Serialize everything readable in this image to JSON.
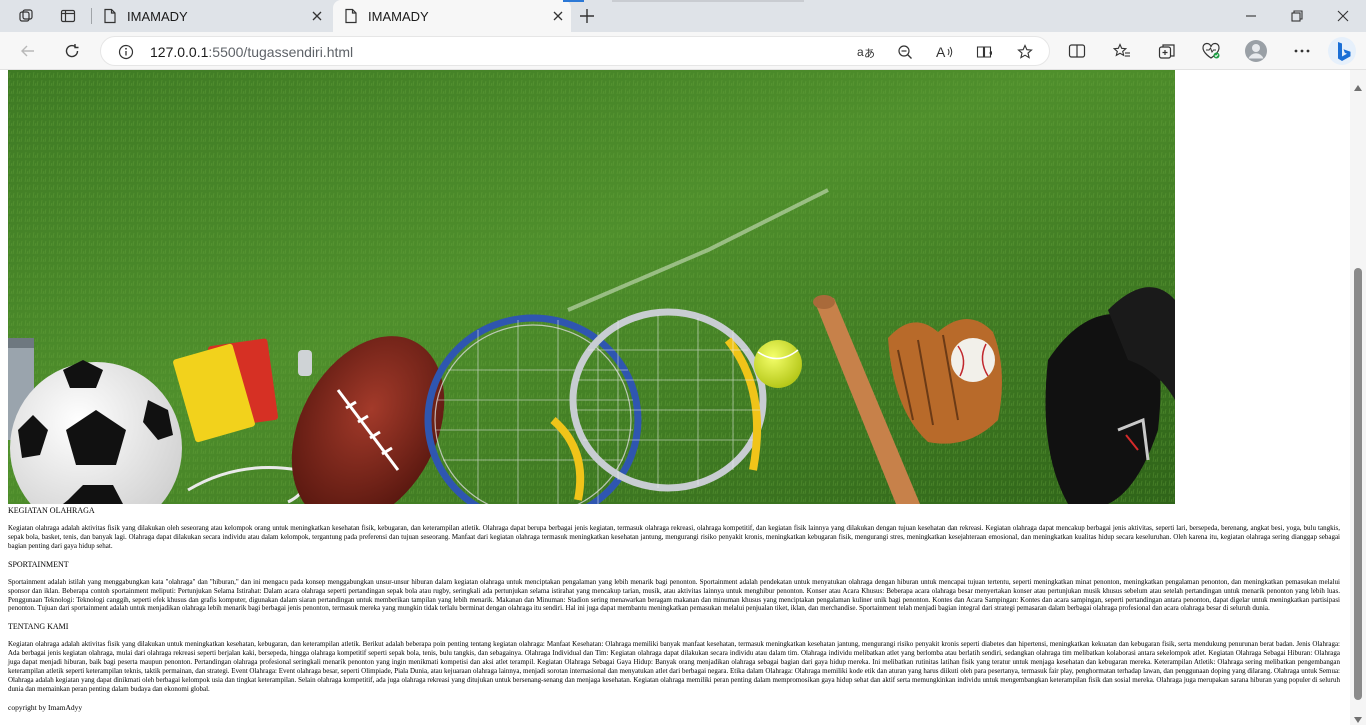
{
  "browser": {
    "tabs": [
      {
        "title": "IMAMADY",
        "active": false
      },
      {
        "title": "IMAMADY",
        "active": true
      }
    ],
    "url_host": "127.0.0.1",
    "url_path": ":5500/tugassendiri.html",
    "accent_color": "#2b78d6"
  },
  "page": {
    "hero_image": "sports-equipment-on-grass",
    "sections": [
      {
        "heading": "KEGIATAN OLAHRAGA",
        "text": "Kegiatan olahraga adalah aktivitas fisik yang dilakukan oleh seseorang atau kelompok orang untuk meningkatkan kesehatan fisik, kebugaran, dan keterampilan atletik. Olahraga dapat berupa berbagai jenis kegiatan, termasuk olahraga rekreasi, olahraga kompetitif, dan kegiatan fisik lainnya yang dilakukan dengan tujuan kesehatan dan rekreasi. Kegiatan olahraga dapat mencakup berbagai jenis aktivitas, seperti lari, bersepeda, berenang, angkat besi, yoga, bulu tangkis, sepak bola, basket, tenis, dan banyak lagi. Olahraga dapat dilakukan secara individu atau dalam kelompok, tergantung pada preferensi dan tujuan seseorang. Manfaat dari kegiatan olahraga termasuk meningkatkan kesehatan jantung, mengurangi risiko penyakit kronis, meningkatkan kebugaran fisik, mengurangi stres, meningkatkan kesejahteraan emosional, dan meningkatkan kualitas hidup secara keseluruhan. Oleh karena itu, kegiatan olahraga sering dianggap sebagai bagian penting dari gaya hidup sehat."
      },
      {
        "heading": "SPORTAINMENT",
        "text": "Sportainment adalah istilah yang menggabungkan kata \"olahraga\" dan \"hiburan,\" dan ini mengacu pada konsep menggabungkan unsur-unsur hiburan dalam kegiatan olahraga untuk menciptakan pengalaman yang lebih menarik bagi penonton. Sportainment adalah pendekatan untuk menyatukan olahraga dengan hiburan untuk mencapai tujuan tertentu, seperti meningkatkan minat penonton, meningkatkan pengalaman penonton, dan meningkatkan pemasukan melalui sponsor dan iklan. Beberapa contoh sportainment meliputi: Pertunjukan Selama Istirahat: Dalam acara olahraga seperti pertandingan sepak bola atau rugby, seringkali ada pertunjukan selama istirahat yang mencakup tarian, musik, atau aktivitas lainnya untuk menghibur penonton. Konser atau Acara Khusus: Beberapa acara olahraga besar menyertakan konser atau pertunjukan musik khusus sebelum atau setelah pertandingan untuk menarik penonton yang lebih luas. Penggunaan Teknologi: Teknologi canggih, seperti efek khusus dan grafis komputer, digunakan dalam siaran pertandingan untuk memberikan tampilan yang lebih menarik. Makanan dan Minuman: Stadion sering menawarkan beragam makanan dan minuman khusus yang menciptakan pengalaman kuliner unik bagi penonton. Kontes dan Acara Sampingan: Kontes dan acara sampingan, seperti pertandingan antara penonton, dapat digelar untuk meningkatkan partisipasi penonton. Tujuan dari sportainment adalah untuk menjadikan olahraga lebih menarik bagi berbagai jenis penonton, termasuk mereka yang mungkin tidak terlalu berminat dengan olahraga itu sendiri. Hal ini juga dapat membantu meningkatkan pemasukan melalui penjualan tiket, iklan, dan merchandise. Sportainment telah menjadi bagian integral dari strategi pemasaran dalam berbagai olahraga profesional dan acara olahraga besar di seluruh dunia."
      },
      {
        "heading": "TENTANG KAMI",
        "text": "Kegiatan olahraga adalah aktivitas fisik yang dilakukan untuk meningkatkan kesehatan, kebugaran, dan keterampilan atletik. Berikut adalah beberapa poin penting tentang kegiatan olahraga: Manfaat Kesehatan: Olahraga memiliki banyak manfaat kesehatan, termasuk meningkatkan kesehatan jantung, mengurangi risiko penyakit kronis seperti diabetes dan hipertensi, meningkatkan kekuatan dan kebugaran fisik, serta mendukung penurunan berat badan. Jenis Olahraga: Ada berbagai jenis kegiatan olahraga, mulai dari olahraga rekreasi seperti berjalan kaki, bersepeda, hingga olahraga kompetitif seperti sepak bola, tenis, bulu tangkis, dan sebagainya. Olahraga Individual dan Tim: Kegiatan olahraga dapat dilakukan secara individu atau dalam tim. Olahraga individu melibatkan atlet yang berlomba atau berlatih sendiri, sedangkan olahraga tim melibatkan kolaborasi antara sekelompok atlet. Kegiatan Olahraga Sebagai Hiburan: Olahraga juga dapat menjadi hiburan, baik bagi peserta maupun penonton. Pertandingan olahraga profesional seringkali menarik penonton yang ingin menikmati kompetisi dan aksi atlet terampil. Kegiatan Olahraga Sebagai Gaya Hidup: Banyak orang menjadikan olahraga sebagai bagian dari gaya hidup mereka. Ini melibatkan rutinitas latihan fisik yang teratur untuk menjaga kesehatan dan kebugaran mereka. Keterampilan Atletik: Olahraga sering melibatkan pengembangan keterampilan atletik seperti keterampilan teknis, taktik permainan, dan strategi. Event Olahraga: Event olahraga besar, seperti Olimpiade, Piala Dunia, atau kejuaraan olahraga lainnya, menjadi sorotan internasional dan menyatukan atlet dari berbagai negara. Etika dalam Olahraga: Olahraga memiliki kode etik dan aturan yang harus diikuti oleh para pesertanya, termasuk fair play, penghormatan terhadap lawan, dan penggunaan doping yang dilarang. Olahraga untuk Semua: Olahraga adalah kegiatan yang dapat dinikmati oleh berbagai kelompok usia dan tingkat keterampilan. Selain olahraga kompetitif, ada juga olahraga rekreasi yang ditujukan untuk bersenang-senang dan menjaga kesehatan. Kegiatan olahraga memiliki peran penting dalam mempromosikan gaya hidup sehat dan aktif serta memungkinkan individu untuk mengembangkan keterampilan fisik dan sosial mereka. Olahraga juga merupakan sarana hiburan yang populer di seluruh dunia dan memainkan peran penting dalam budaya dan ekonomi global."
      }
    ],
    "copyright": "copyright by ImamAdyy"
  }
}
